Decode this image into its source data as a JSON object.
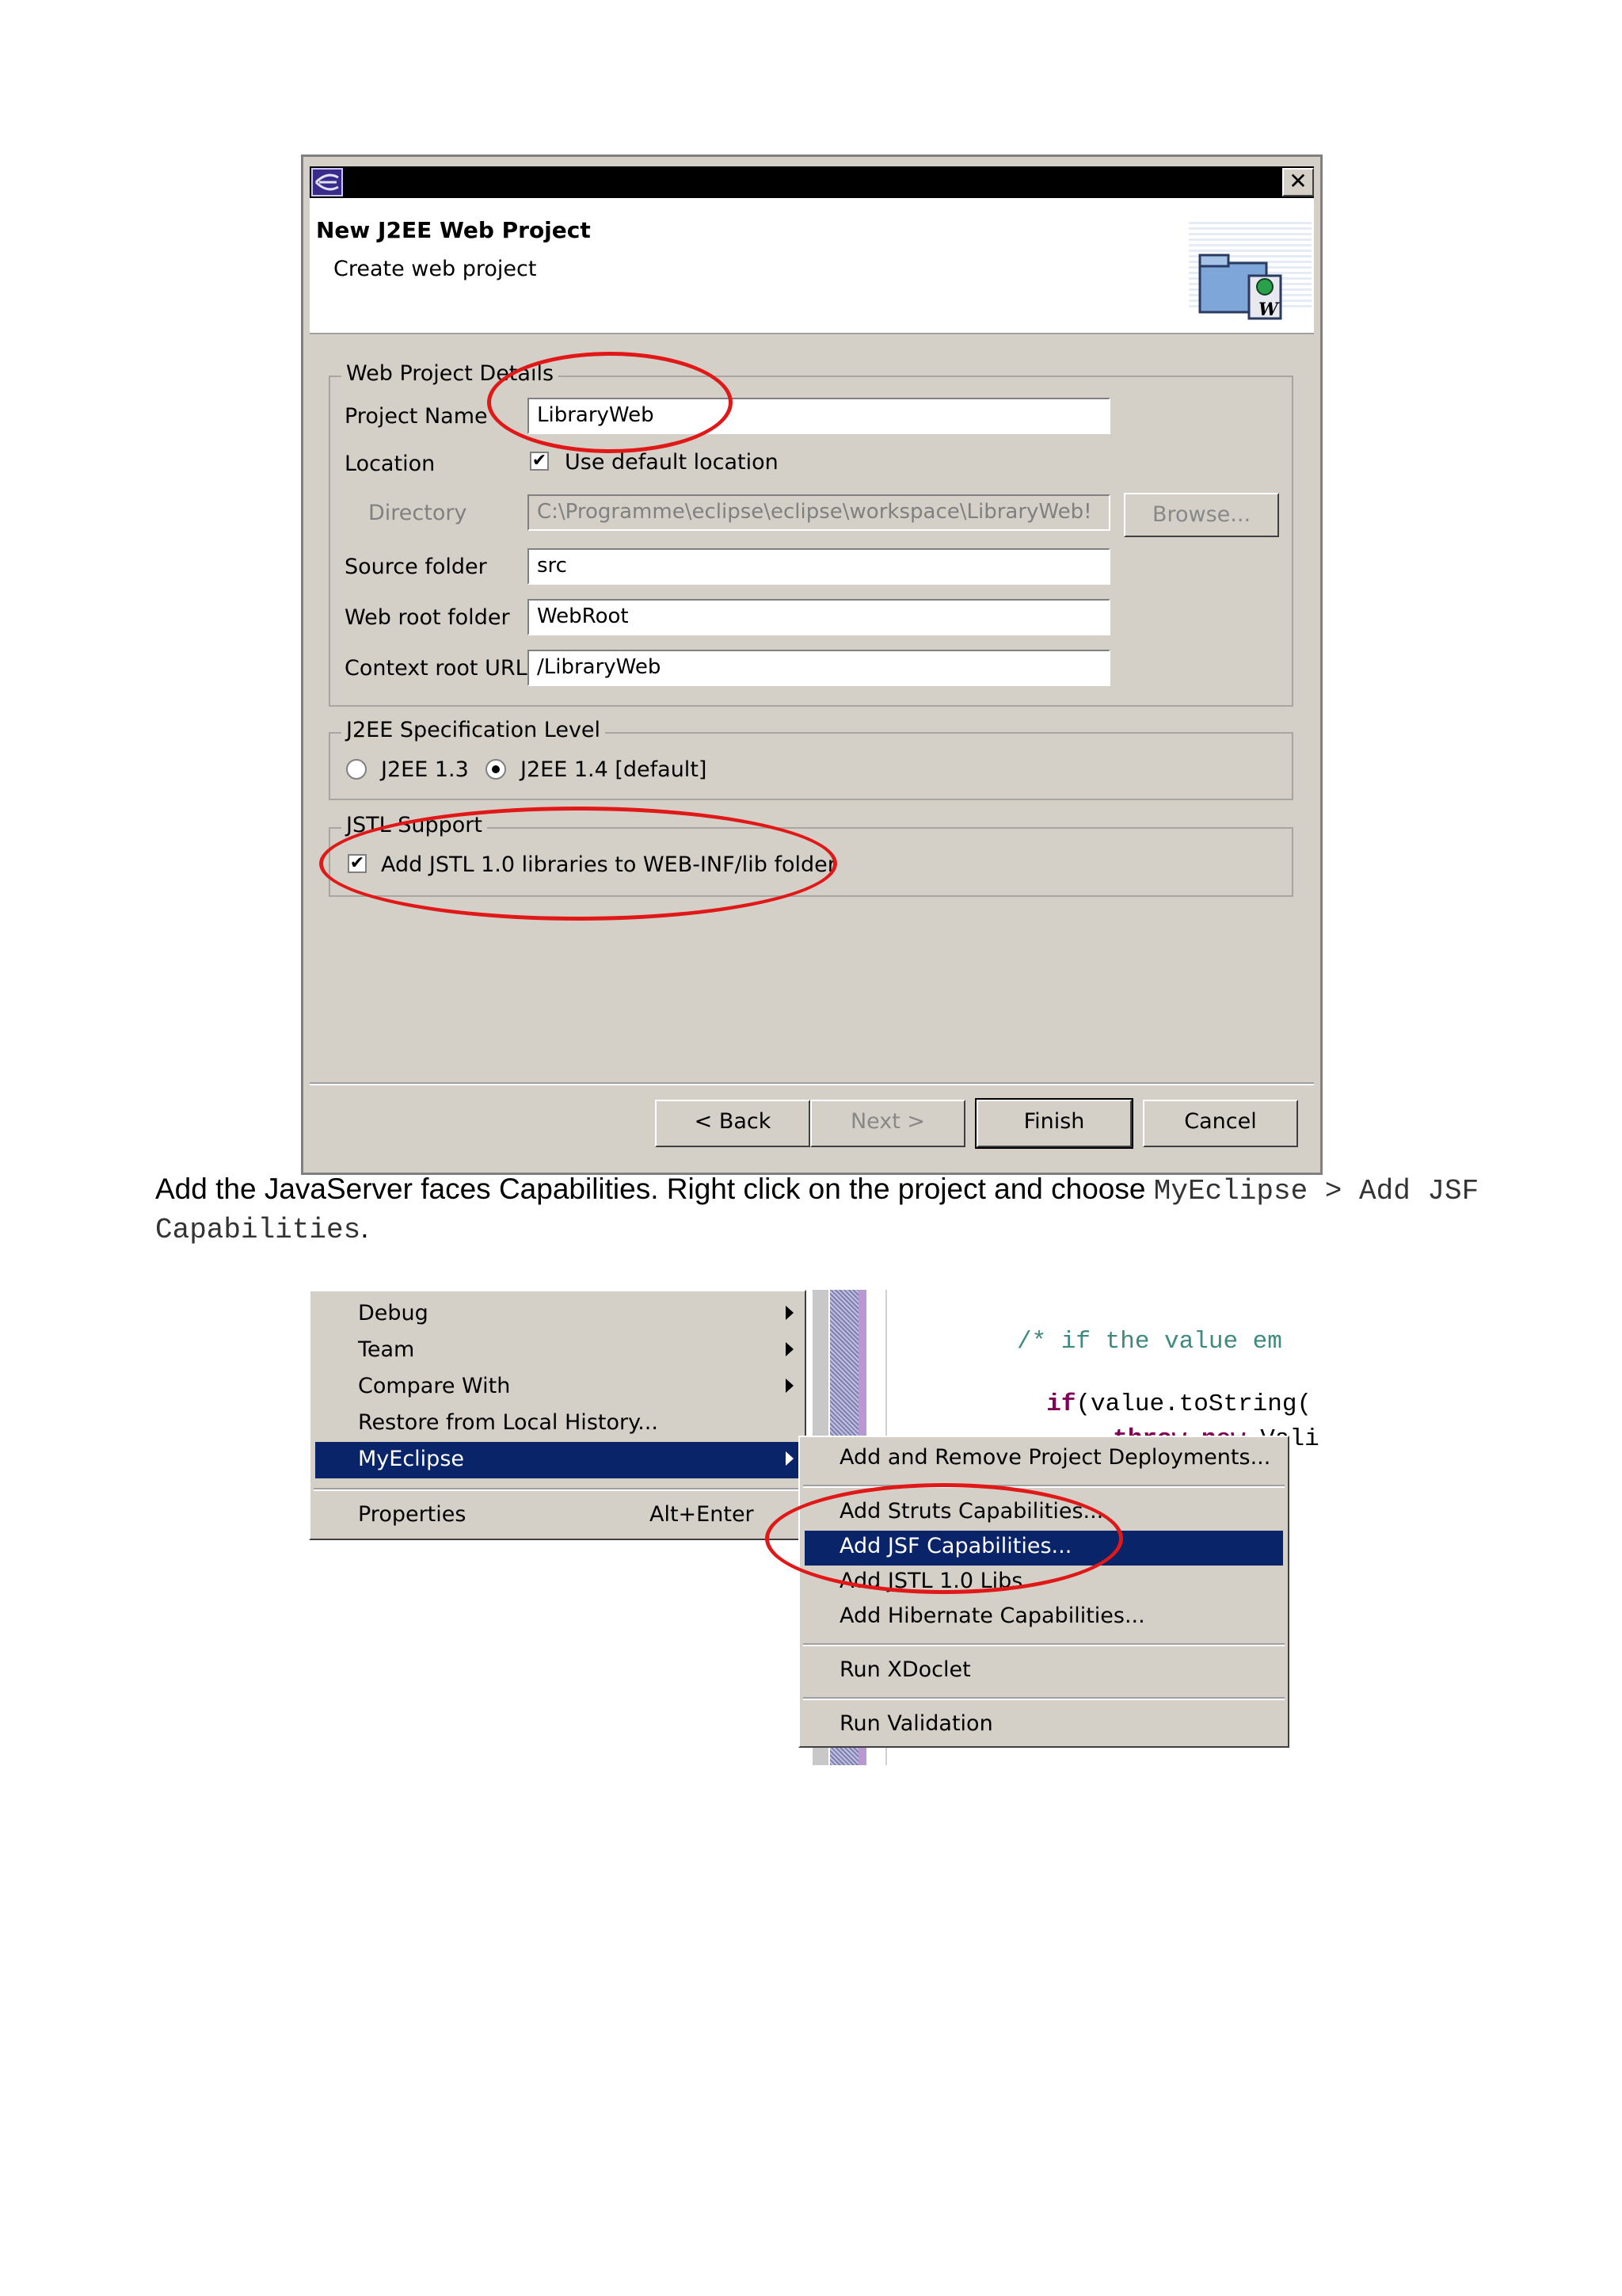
{
  "dialog": {
    "title": "New J2EE Web Project",
    "subtitle": "Create web project",
    "close_glyph": "✕",
    "groups": {
      "details": "Web Project Details",
      "spec": "J2EE Specification Level",
      "jstl": "JSTL Support"
    },
    "fields": {
      "project_name_label": "Project Name",
      "project_name_value": "LibraryWeb",
      "location_label": "Location",
      "use_default_label": "Use default location",
      "directory_label": "Directory",
      "directory_value": "C:\\Programme\\eclipse\\eclipse\\workspace\\LibraryWeb!",
      "browse_label": "Browse...",
      "source_folder_label": "Source folder",
      "source_folder_value": "src",
      "web_root_label": "Web root folder",
      "web_root_value": "WebRoot",
      "context_root_label": "Context root URL",
      "context_root_value": "/LibraryWeb"
    },
    "spec": {
      "option_13": "J2EE 1.3",
      "option_14": "J2EE 1.4 [default]",
      "selected": "J2EE 1.4 [default]"
    },
    "jstl_checkbox_label": "Add JSTL 1.0 libraries to WEB-INF/lib folder",
    "buttons": {
      "back": "< Back",
      "next": "Next >",
      "finish": "Finish",
      "cancel": "Cancel"
    },
    "highlight_color": "#e01818"
  },
  "paragraph": {
    "text_a": "Add the JavaServer faces Capabilities. Right click on the project and choose ",
    "code": "MyEclipse > Add JSF Capabilities",
    "text_b": "."
  },
  "context_menu": {
    "items": [
      "Debug",
      "Team",
      "Compare With",
      "Restore from Local History...",
      "MyEclipse"
    ],
    "properties_label": "Properties",
    "properties_shortcut": "Alt+Enter",
    "selected": "MyEclipse"
  },
  "submenu": {
    "items": [
      "Add and Remove Project Deployments...",
      "Add Struts Capabilities...",
      "Add JSF Capabilities...",
      "Add JSTL 1.0 Libs",
      "Add Hibernate Capabilities...",
      "Run XDoclet",
      "Run Validation"
    ],
    "selected": "Add JSF Capabilities..."
  },
  "code": {
    "line1": "/* if the value em",
    "line2_kw": "if",
    "line2_rest": "(value.toString(",
    "line3_kw1": "throw",
    "line3_kw2": "new",
    "line3_rest": "Vali"
  },
  "selection_color": "#0a246a"
}
